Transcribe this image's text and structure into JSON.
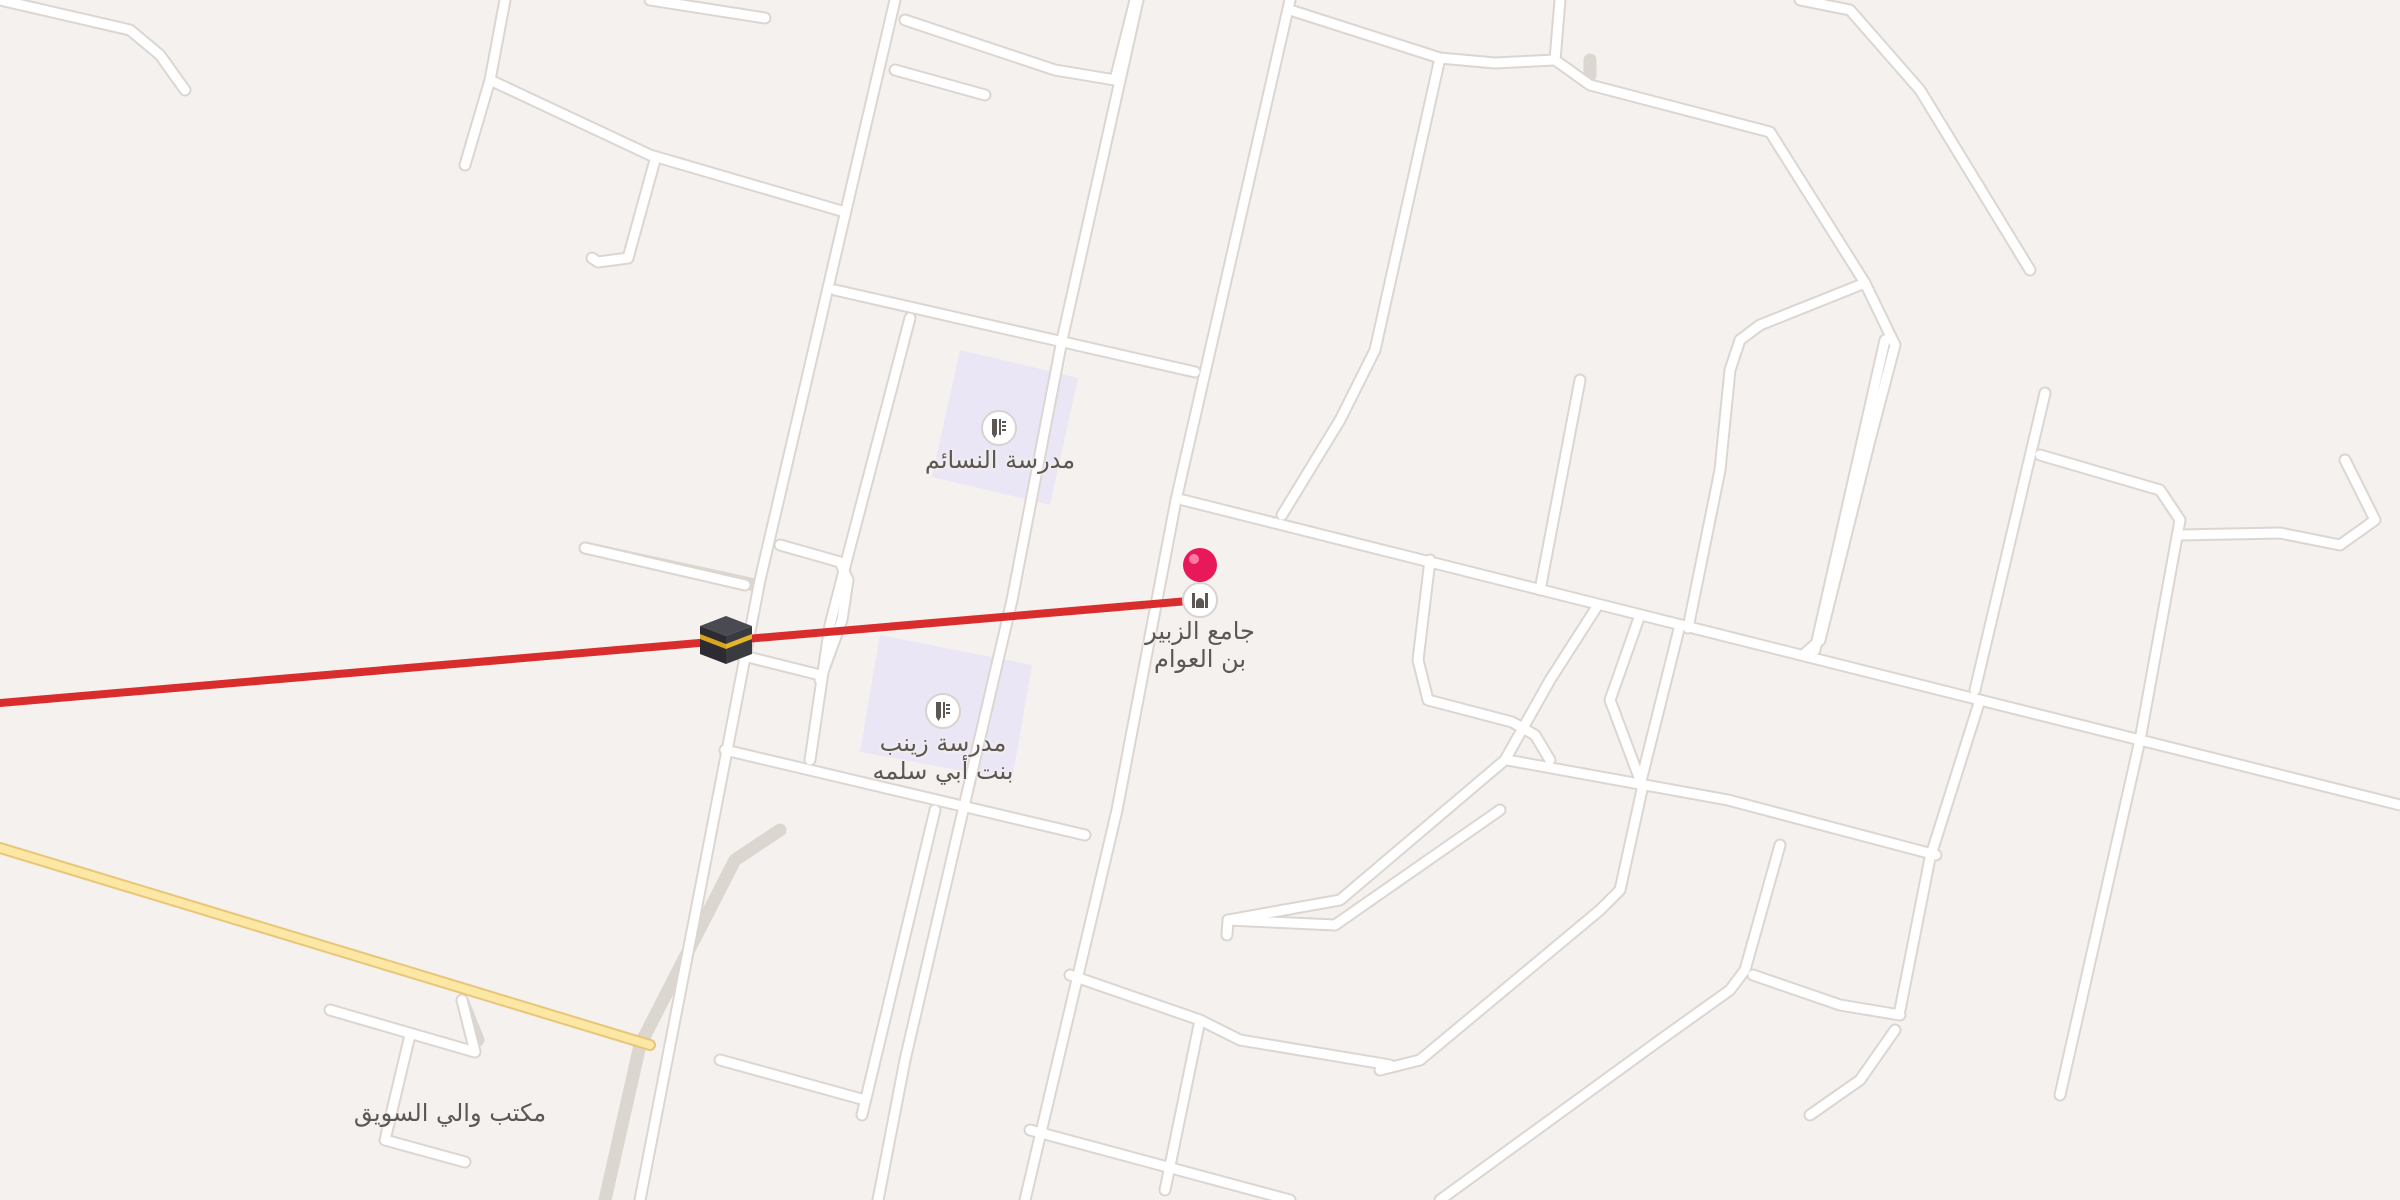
{
  "map": {
    "colors": {
      "background": "#f4f1ee",
      "road": "#ffffff",
      "road_casing": "#dcd6d1",
      "major_road": "#fde7a5",
      "major_road_casing": "#e8c678",
      "school_area": "#ebe6f5",
      "route": "#d92d2d",
      "pin": "#e8195a",
      "label_text": "#5d5754"
    },
    "route": {
      "description_icon": "kaaba-icon"
    },
    "pois": [
      {
        "name": "مدرسة النسائم",
        "icon": "school-icon"
      },
      {
        "name_line1": "مدرسة زينب",
        "name_line2": "بنت أبي سلمه",
        "icon": "school-icon"
      },
      {
        "name_line1": "جامع الزبير",
        "name_line2": "بن العوام",
        "icon": "mosque-icon"
      },
      {
        "name": "مكتب والي السويق"
      }
    ],
    "pin": {
      "icon": "location-pin-icon"
    }
  }
}
